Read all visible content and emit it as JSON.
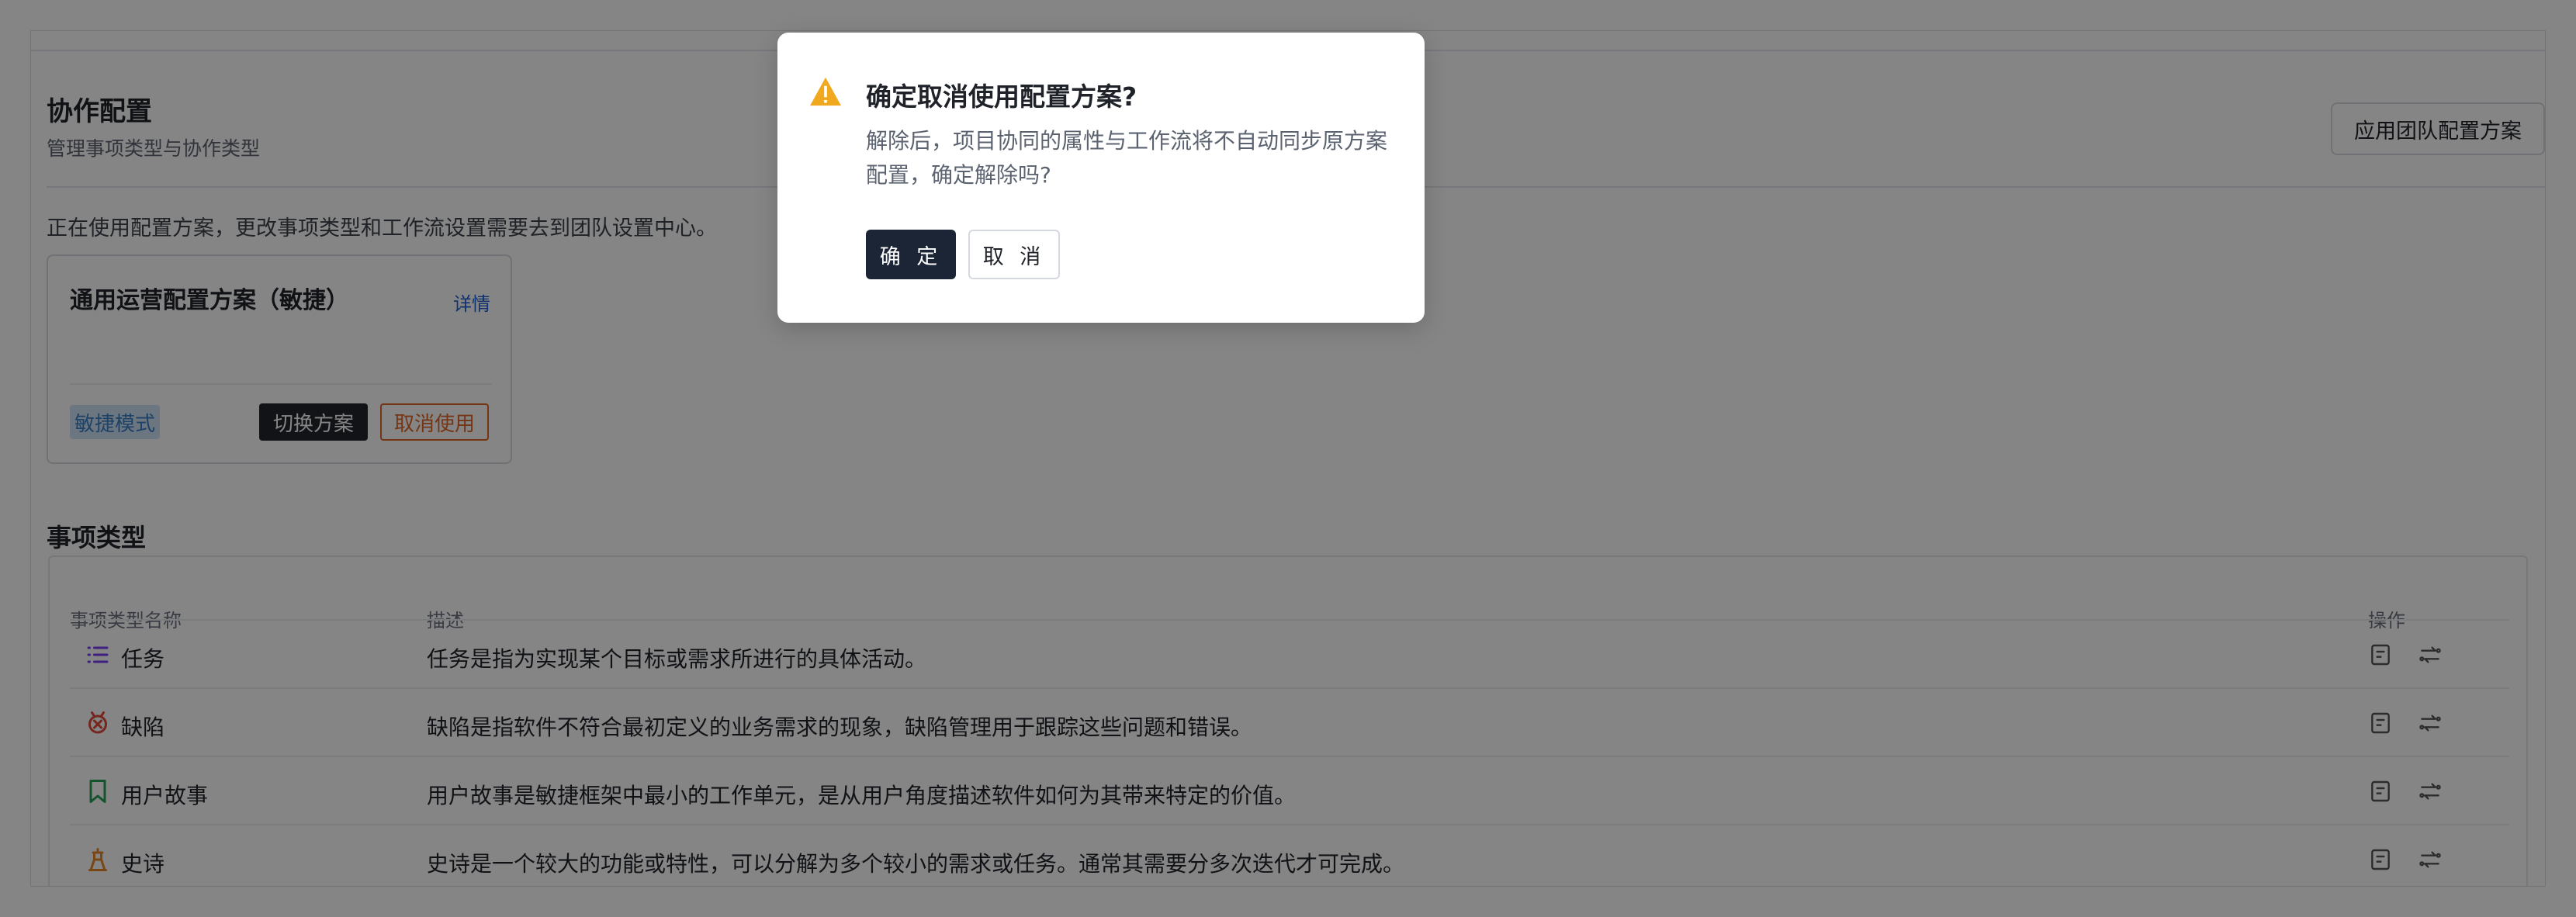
{
  "page": {
    "title": "协作配置",
    "subtitle": "管理事项类型与协作类型",
    "apply_button": "应用团队配置方案",
    "notice": "正在使用配置方案，更改事项类型和工作流设置需要去到团队设置中心。"
  },
  "scheme_card": {
    "name": "通用运营配置方案（敏捷）",
    "detail_link": "详情",
    "mode_tag": "敏捷模式",
    "switch_button": "切换方案",
    "cancel_use_button": "取消使用"
  },
  "issue_types": {
    "section_title": "事项类型",
    "columns": {
      "name": "事项类型名称",
      "description": "描述",
      "actions": "操作"
    },
    "rows": [
      {
        "name": "任务",
        "icon": "task-list-icon",
        "color": "#7b3ff2",
        "description": "任务是指为实现某个目标或需求所进行的具体活动。"
      },
      {
        "name": "缺陷",
        "icon": "bug-icon",
        "color": "#e04a3a",
        "description": "缺陷是指软件不符合最初定义的业务需求的现象，缺陷管理用于跟踪这些问题和错误。"
      },
      {
        "name": "用户故事",
        "icon": "bookmark-icon",
        "color": "#2aa05a",
        "description": "用户故事是敏捷框架中最小的工作单元，是从用户角度描述软件如何为其带来特定的价值。"
      },
      {
        "name": "史诗",
        "icon": "epic-icon",
        "color": "#e8862a",
        "description": "史诗是一个较大的功能或特性，可以分解为多个较小的需求或任务。通常其需要分多次迭代才可完成。"
      }
    ]
  },
  "dialog": {
    "title": "确定取消使用配置方案?",
    "body": "解除后，项目协同的属性与工作流将不自动同步原方案配置，确定解除吗?",
    "confirm": "确 定",
    "cancel": "取 消",
    "warn_color": "#f0a81e"
  }
}
